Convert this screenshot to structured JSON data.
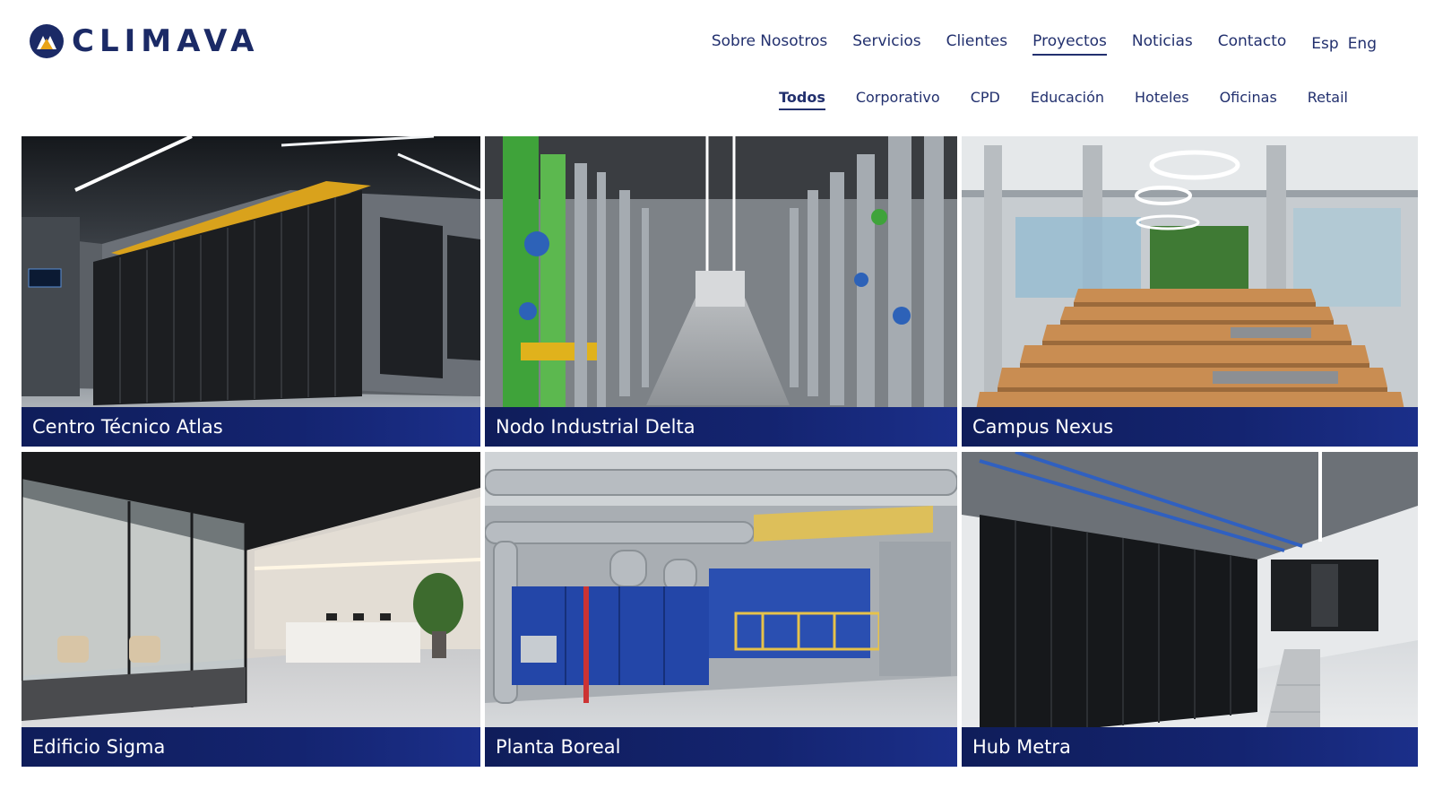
{
  "brand": {
    "name": "CLIMAVA",
    "logo_icon": "mountain-circle-logo-icon",
    "primary_color": "#1b2a66",
    "accent_color": "#e8a317"
  },
  "nav": {
    "items": [
      {
        "label": "Sobre Nosotros",
        "active": false
      },
      {
        "label": "Servicios",
        "active": false
      },
      {
        "label": "Clientes",
        "active": false
      },
      {
        "label": "Proyectos",
        "active": true
      },
      {
        "label": "Noticias",
        "active": false
      },
      {
        "label": "Contacto",
        "active": false
      }
    ],
    "languages": [
      "Esp",
      "Eng"
    ]
  },
  "filters": [
    {
      "label": "Todos",
      "active": true
    },
    {
      "label": "Corporativo",
      "active": false
    },
    {
      "label": "CPD",
      "active": false
    },
    {
      "label": "Educación",
      "active": false
    },
    {
      "label": "Hoteles",
      "active": false
    },
    {
      "label": "Oficinas",
      "active": false
    },
    {
      "label": "Retail",
      "active": false
    }
  ],
  "projects": [
    {
      "title": "Centro Técnico Atlas",
      "scene": "data-center-racks-photo"
    },
    {
      "title": "Nodo Industrial Delta",
      "scene": "industrial-pipes-photo"
    },
    {
      "title": "Campus Nexus",
      "scene": "atrium-stairs-photo"
    },
    {
      "title": "Edificio Sigma",
      "scene": "office-lobby-photo"
    },
    {
      "title": "Planta Boreal",
      "scene": "hvac-plant-photo"
    },
    {
      "title": "Hub Metra",
      "scene": "server-room-photo"
    }
  ],
  "caption_color": "#0f1d5a"
}
